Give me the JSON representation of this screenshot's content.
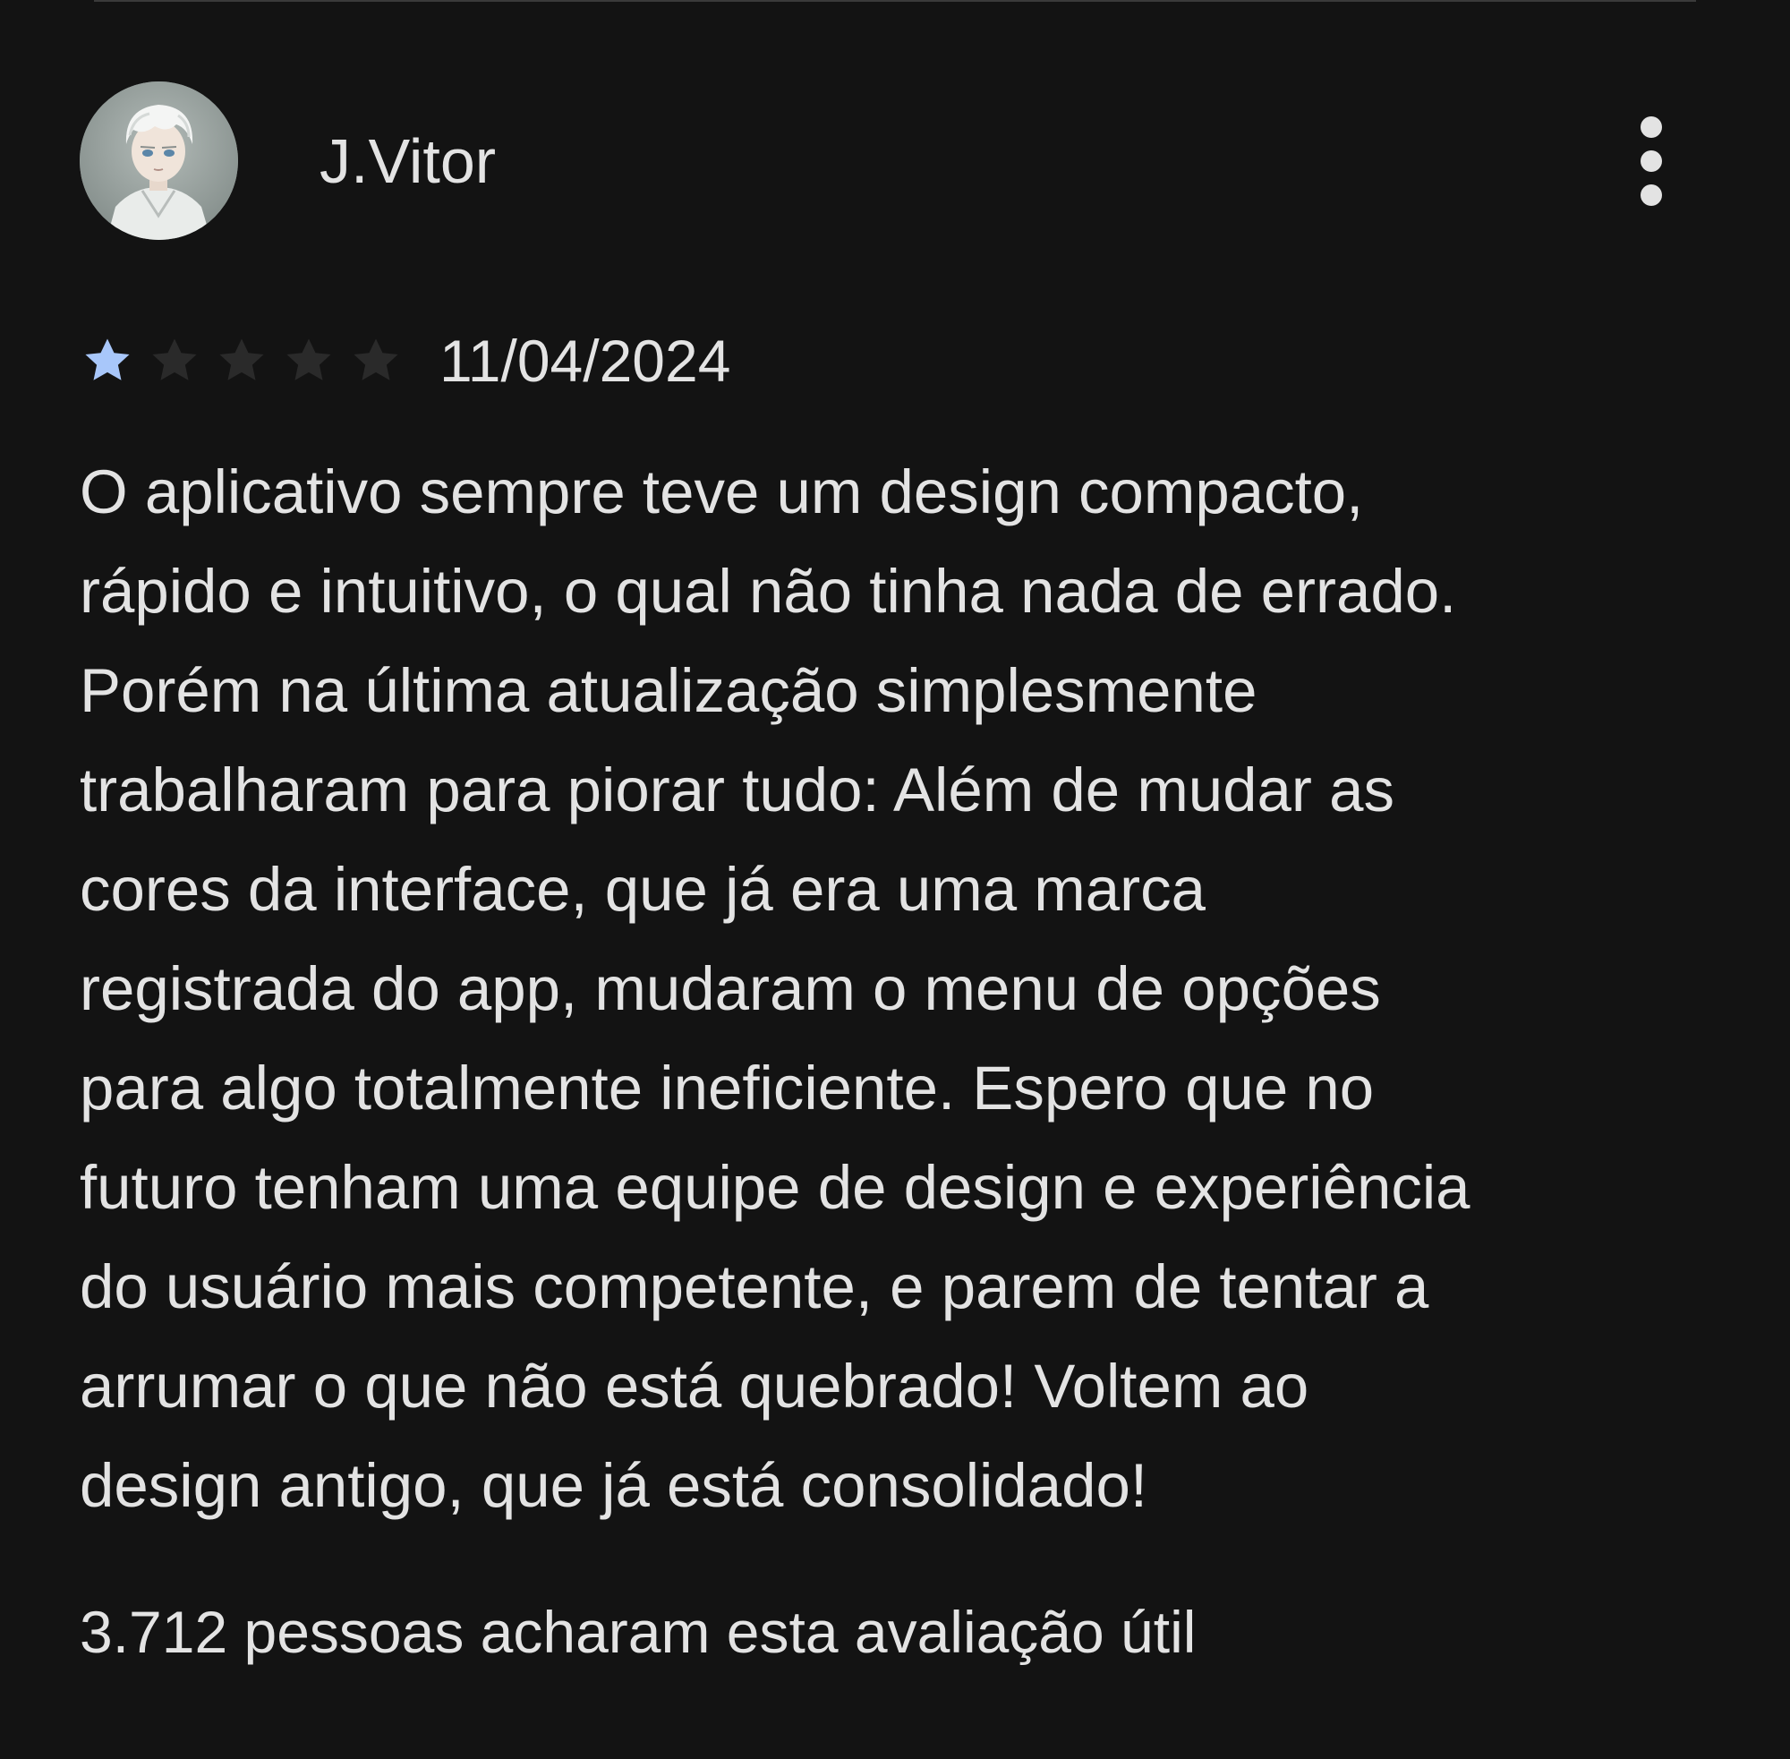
{
  "colors": {
    "background": "#131313",
    "text": "#e3e3e3",
    "star_filled": "#a8c7fa",
    "star_empty": "#2a2a2a"
  },
  "review": {
    "reviewer_name": "J.Vitor",
    "avatar_icon": "anime-character-avatar",
    "more_icon": "more-vert-icon",
    "rating": 1,
    "rating_max": 5,
    "date": "11/04/2024",
    "text_lines": [
      "O aplicativo sempre teve um design compacto,",
      "rápido e intuitivo, o qual não tinha nada de errado.",
      "Porém na última atualização simplesmente",
      "trabalharam para piorar tudo: Além de mudar as",
      "cores da interface, que já era uma marca",
      "registrada do app, mudaram o menu de opções",
      "para algo totalmente ineficiente. Espero que no",
      "futuro tenham uma equipe de design e experiência",
      "do usuário mais competente, e parem de tentar a",
      "arrumar o que não está quebrado! Voltem ao",
      "design antigo, que já está consolidado!"
    ],
    "helpful_text": "3.712 pessoas acharam esta avaliação útil"
  }
}
